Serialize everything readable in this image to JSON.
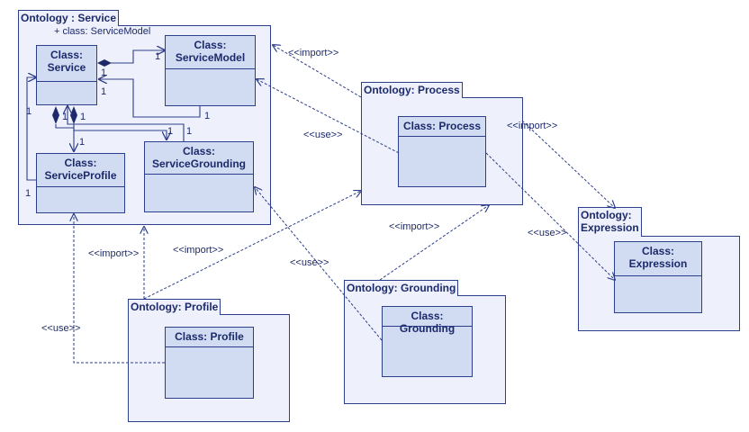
{
  "packages": {
    "service": {
      "title": "Ontology : Service",
      "attribute": "+ class: ServiceModel"
    },
    "process": {
      "title": "Ontology: Process"
    },
    "expression": {
      "title_line1": "Ontology:",
      "title_line2": "Expression"
    },
    "profile": {
      "title": "Ontology: Profile"
    },
    "grounding": {
      "title": "Ontology: Grounding"
    }
  },
  "classes": {
    "service": {
      "line1": "Class:",
      "line2": "Service"
    },
    "service_model": {
      "line1": "Class:",
      "line2": "ServiceModel"
    },
    "service_profile": {
      "line1": "Class:",
      "line2": "ServiceProfile"
    },
    "service_grounding": {
      "line1": "Class:",
      "line2": "ServiceGrounding"
    },
    "process": {
      "line1": "Class: Process"
    },
    "expression": {
      "line1": "Class:",
      "line2": "Expression"
    },
    "profile": {
      "line1": "Class: Profile"
    },
    "grounding": {
      "line1": "Class: Grounding"
    }
  },
  "relations": {
    "import_label": "<<import>>",
    "use_label": "<<use>>"
  },
  "multiplicities": {
    "one": "1"
  },
  "colors": {
    "border": "#2d3e8c",
    "package_fill": "#eef1fb",
    "class_fill": "#d1dcf3",
    "text": "#1c2a6b"
  }
}
